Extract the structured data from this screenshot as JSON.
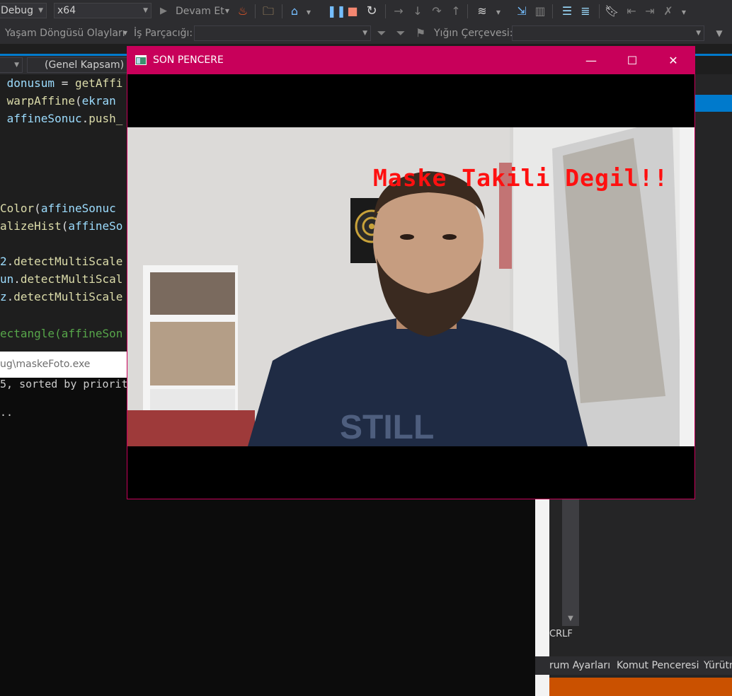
{
  "toolbar": {
    "config_value": "Debug",
    "platform_value": "x64",
    "continue_label": "Devam Et",
    "lifecycle_label": "Yaşam Döngüsü Olayları",
    "thread_label": "İş Parçacığı:",
    "stackframe_label": "Yığın Çerçevesi:"
  },
  "editor": {
    "scope_label": "(Genel Kapsam)",
    "lines": [
      {
        "a": " donusum",
        "b": " = ",
        "c": "getAffi"
      },
      {
        "a": " warpAffine",
        "b": "(",
        "c": "ekran"
      },
      {
        "a": " affineSonuc",
        "b": ".",
        "c": "push_"
      }
    ],
    "lines2": [
      {
        "a": "Color",
        "b": "(",
        "c": "affineSonuc"
      },
      {
        "a": "alizeHist",
        "b": "(",
        "c": "affineSo"
      },
      {
        "a": "2",
        "b": ".",
        "c": "detectMultiScale"
      },
      {
        "a": "un",
        "b": ".",
        "c": "detectMultiScal"
      },
      {
        "a": "z",
        "b": ".",
        "c": "detectMultiScale"
      },
      {
        "a": "ectangle",
        "b": "(",
        "c": "affineSon"
      }
    ]
  },
  "output": {
    "path": "ug\\maskeFoto.exe",
    "line1": "5, sorted by priorit",
    "line2": ".."
  },
  "right": {
    "crlf": "CRLF",
    "tabs": [
      "rum Ayarları",
      "Komut Penceresi",
      "Yürütm"
    ]
  },
  "window": {
    "title": "SON PENCERE",
    "minimize": "—",
    "maximize": "☐",
    "close": "✕",
    "overlay_text": "Maske Takili Degil!!"
  },
  "colors": {
    "accent": "#007acc",
    "title_bar": "#c8005a",
    "overlay_text": "#ff1010",
    "status_bar": "#ca5100"
  }
}
